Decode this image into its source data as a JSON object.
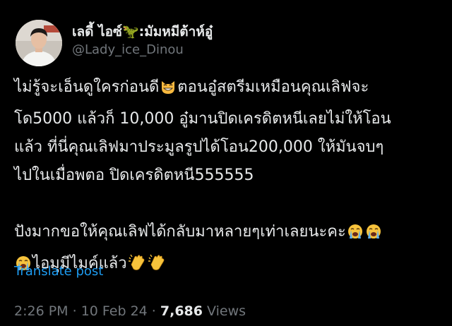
{
  "author": {
    "display_name": "เลดี้ ไอซ์🦖:มัมหมีต้าห์อู๋",
    "handle": "@Lady_ice_Dinou"
  },
  "tweet": {
    "line1": "ไม่รู้จะเอ็นดูใครก่อนดี",
    "line1b": "ตอนอู๋สตรีมเหมือนคุณเลิฟจะ",
    "line2": "โด5000 แล้วก็ 10,000 อู๋มานปิดเครดิตหนีเลยไม่ให้โอน",
    "line3": "แล้ว ที่นี่คุณเลิฟมาประมูลรูปได้โอน200,000 ให้มันจบๆ",
    "line4": "ไปในเมื่อพตอ  ปิดเครดิตหนี555555",
    "line5": "ปังมากขอให้คุณเลิฟได้กลับมาหลายๆเท่าเลยนะคะ",
    "line6": "ไอมุมีไมค์แล้ว"
  },
  "emoji": {
    "smile_cat": "grinning-cat-emoji",
    "crying": "loudly-crying-face-emoji",
    "clap": "clapping-hands-emoji"
  },
  "translate_label": "Translate post",
  "meta": {
    "time": "2:26 PM",
    "sep1": " · ",
    "date": "10 Feb 24",
    "sep2": " · ",
    "views_count": "7,686",
    "views_label": " Views"
  },
  "colors": {
    "background": "#000000",
    "text": "#e7e9ea",
    "muted": "#71767b",
    "link": "#1d9bf0"
  }
}
